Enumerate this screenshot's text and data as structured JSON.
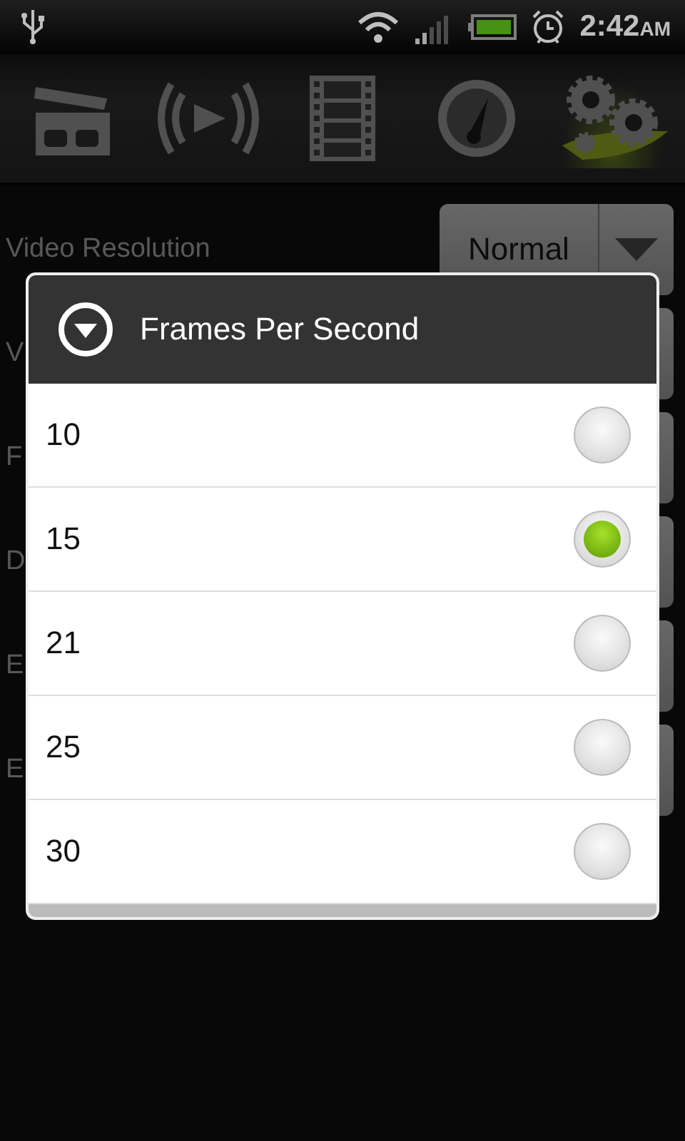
{
  "status_bar": {
    "time": "2:42",
    "period": "AM"
  },
  "toolbar": [
    {
      "kind": "clapper",
      "selected": false
    },
    {
      "kind": "broadcast",
      "selected": false
    },
    {
      "kind": "film",
      "selected": false
    },
    {
      "kind": "gauge",
      "selected": false
    },
    {
      "kind": "gears",
      "selected": true
    }
  ],
  "settings": [
    {
      "label": "Video Resolution",
      "value": "Normal"
    },
    {
      "label": "V"
    },
    {
      "label": "F"
    },
    {
      "label": "D"
    },
    {
      "label": "E"
    },
    {
      "label": "E"
    }
  ],
  "dialog": {
    "title": "Frames Per Second",
    "options": [
      {
        "label": "10",
        "selected": false
      },
      {
        "label": "15",
        "selected": true
      },
      {
        "label": "21",
        "selected": false
      },
      {
        "label": "25",
        "selected": false
      },
      {
        "label": "30",
        "selected": false
      }
    ]
  }
}
